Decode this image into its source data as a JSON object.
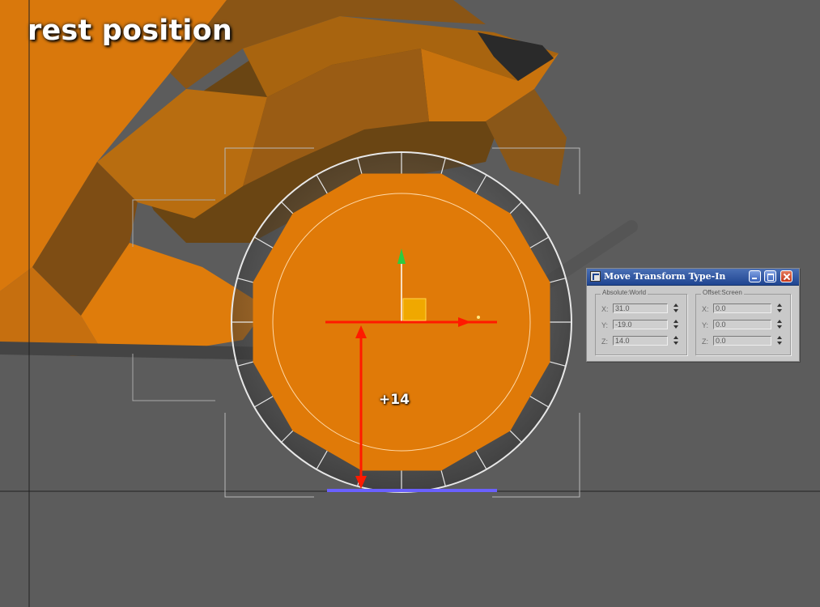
{
  "caption": "rest position",
  "offset_label": "+14",
  "colors": {
    "viewport_bg": "#5c5c5c",
    "orange_geometry": "#e07a08",
    "dark_orange_geometry": "#7a4a10",
    "gizmo_x_axis": "#ff1a00",
    "gizmo_y_axis": "#2ecc40",
    "ground_contact": "#6a60ff",
    "dialog_titlebar": "#1f4591"
  },
  "dialog": {
    "title": "Move Transform Type-In",
    "absolute_world": {
      "label": "Absolute:World",
      "fields": [
        {
          "axis": "X:",
          "value": "31.0"
        },
        {
          "axis": "Y:",
          "value": "-19.0"
        },
        {
          "axis": "Z:",
          "value": "14.0"
        }
      ]
    },
    "offset_screen": {
      "label": "Offset:Screen",
      "fields": [
        {
          "axis": "X:",
          "value": "0.0"
        },
        {
          "axis": "Y:",
          "value": "0.0"
        },
        {
          "axis": "Z:",
          "value": "0.0"
        }
      ]
    }
  }
}
